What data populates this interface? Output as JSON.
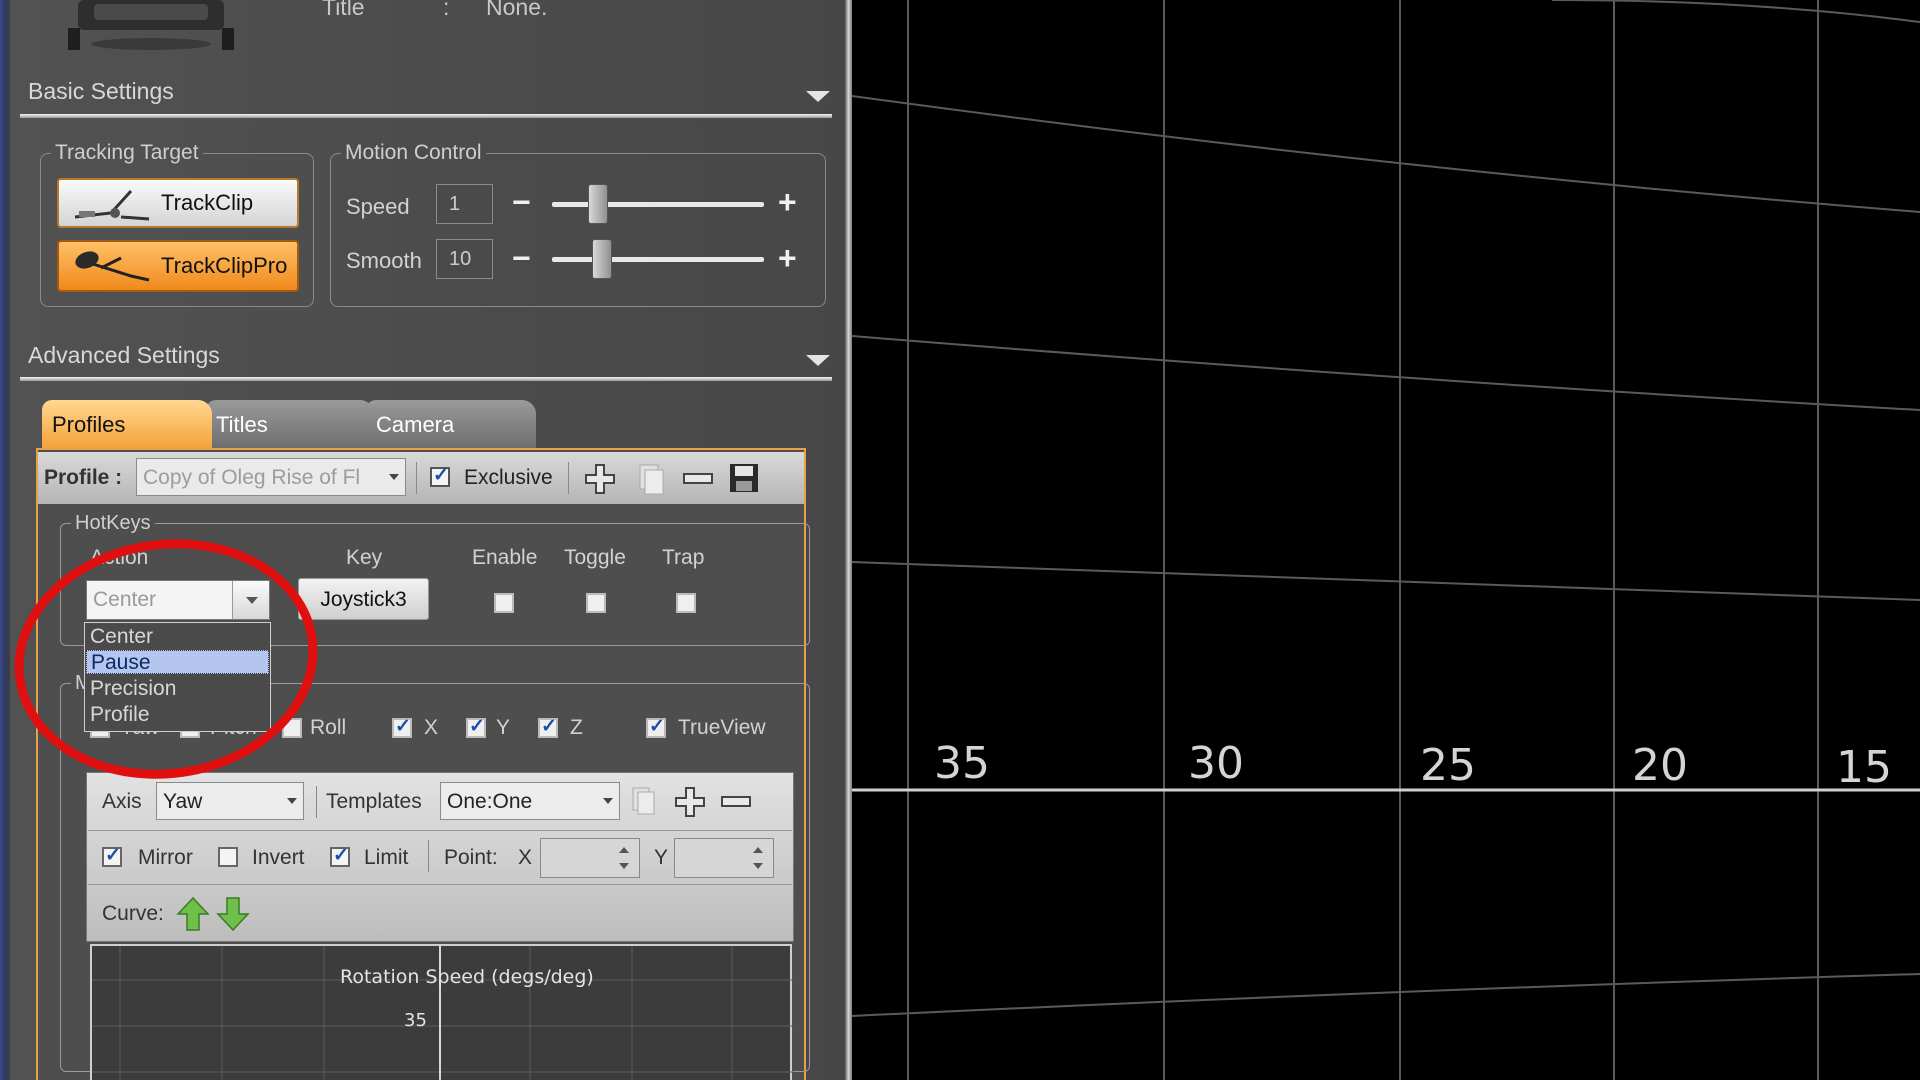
{
  "header": {
    "title_label": "Title",
    "colon": ":",
    "title_value": "None."
  },
  "basic_settings": {
    "title": "Basic Settings",
    "tracking_target": {
      "legend": "Tracking Target",
      "buttons": [
        "TrackClip",
        "TrackClipPro"
      ]
    },
    "motion_control": {
      "legend": "Motion Control",
      "speed": {
        "label": "Speed",
        "value": "1",
        "level": 0.22
      },
      "smooth": {
        "label": "Smooth",
        "value": "10",
        "level": 0.24
      },
      "minus": "−",
      "plus": "+"
    }
  },
  "advanced_settings": {
    "title": "Advanced Settings",
    "tabs": [
      "Profiles",
      "Titles",
      "Camera"
    ],
    "active_tab": "Profiles",
    "profile": {
      "label": "Profile :",
      "value": "Copy of Oleg Rise of Fl",
      "exclusive_label": "Exclusive",
      "exclusive_checked": true
    },
    "hotkeys": {
      "legend": "HotKeys",
      "headers": [
        "Action",
        "Key",
        "Enable",
        "Toggle",
        "Trap"
      ],
      "action_value": "Center",
      "action_options": [
        "Center",
        "Pause",
        "Precision",
        "Profile"
      ],
      "selected_option": "Pause",
      "key_value": "Joystick3"
    },
    "axes_row": {
      "hidden_legend": "M",
      "items": [
        {
          "label": "Yaw",
          "checked": true
        },
        {
          "label": "Pitch",
          "checked": true
        },
        {
          "label": "Roll",
          "checked": false
        },
        {
          "label": "X",
          "checked": true
        },
        {
          "label": "Y",
          "checked": true
        },
        {
          "label": "Z",
          "checked": true
        },
        {
          "label": "TrueView",
          "checked": true
        }
      ]
    },
    "axis_panel": {
      "axis_label": "Axis",
      "axis_value": "Yaw",
      "templates_label": "Templates",
      "templates_value": "One:One",
      "mirror_label": "Mirror",
      "invert_label": "Invert",
      "limit_label": "Limit",
      "point_label": "Point:",
      "x_label": "X",
      "y_label": "Y",
      "curve_label": "Curve:"
    },
    "graph": {
      "title": "Rotation Speed (degs/deg)",
      "tick": "35"
    }
  },
  "viewport": {
    "tick_labels": [
      "35",
      "30",
      "25",
      "20",
      "15"
    ]
  },
  "colors": {
    "accent_orange": "#f5a23a",
    "selection_blue": "#b4c6ef",
    "annotation_red": "#e01010"
  }
}
